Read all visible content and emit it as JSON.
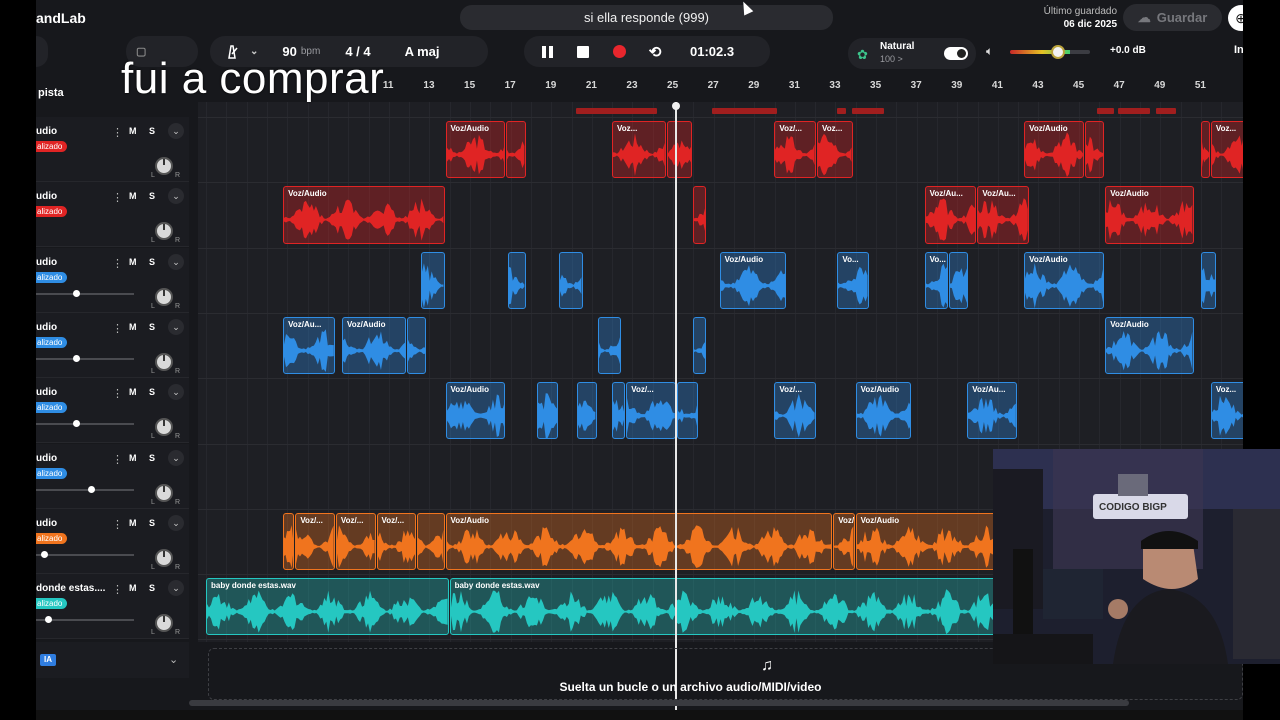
{
  "app": {
    "logo": "andLab",
    "project_title": "si ella responde (999)",
    "last_saved_label": "Último guardado",
    "last_saved_date": "06 dic 2025",
    "save_label": "Guardar"
  },
  "transport": {
    "bpm": "90",
    "bpm_unit": "bpm",
    "time_sig": "4 / 4",
    "key": "A maj",
    "time": "01:02.3",
    "preset_name": "Natural",
    "preset_value": "100 >",
    "master_db": "+0.0 dB",
    "master_volume_fraction": 0.6,
    "right_cut": "In"
  },
  "sidebar": {
    "add_track_label": "pista",
    "tracks": [
      {
        "name": "udio",
        "badge": "alizado",
        "color": "#e02424",
        "has_fader": false
      },
      {
        "name": "udio",
        "badge": "alizado",
        "color": "#e02424",
        "has_fader": false
      },
      {
        "name": "udio",
        "badge": "alizado",
        "color": "#2f8de4",
        "has_fader": true,
        "fader": 0.4
      },
      {
        "name": "udio",
        "badge": "alizado",
        "color": "#2f8de4",
        "has_fader": true,
        "fader": 0.4
      },
      {
        "name": "udio",
        "badge": "alizado",
        "color": "#2f8de4",
        "has_fader": true,
        "fader": 0.4
      },
      {
        "name": "udio",
        "badge": "alizado",
        "color": "#2f8de4",
        "has_fader": true,
        "fader": 0.57
      },
      {
        "name": "udio",
        "badge": "alizado",
        "color": "#f0741e",
        "has_fader": true,
        "fader": 0.05
      },
      {
        "name": "donde estas....",
        "badge": "alizado",
        "color": "#25c7c1",
        "has_fader": true,
        "fader": 0.1
      }
    ],
    "mute_label": "M",
    "solo_label": "S",
    "ia_label": "IA"
  },
  "ruler": {
    "bars": [
      "11",
      "13",
      "15",
      "17",
      "19",
      "21",
      "23",
      "25",
      "27",
      "29",
      "31",
      "33",
      "35",
      "37",
      "39",
      "41",
      "43",
      "45",
      "47",
      "49",
      "51"
    ]
  },
  "clips": [
    {
      "track": 0,
      "start": 11.8,
      "end": 14.8,
      "label": "Voz/Audio"
    },
    {
      "track": 0,
      "start": 14.8,
      "end": 15.8,
      "label": ""
    },
    {
      "track": 0,
      "start": 20.0,
      "end": 22.7,
      "label": "Voz..."
    },
    {
      "track": 0,
      "start": 22.7,
      "end": 24.0,
      "label": ""
    },
    {
      "track": 0,
      "start": 28.0,
      "end": 30.1,
      "label": "Voz/..."
    },
    {
      "track": 0,
      "start": 30.1,
      "end": 31.9,
      "label": "Voz..."
    },
    {
      "track": 0,
      "start": 40.3,
      "end": 43.3,
      "label": "Voz/Audio"
    },
    {
      "track": 0,
      "start": 43.3,
      "end": 44.3,
      "label": ""
    },
    {
      "track": 0,
      "start": 49.0,
      "end": 49.5,
      "label": ""
    },
    {
      "track": 0,
      "start": 49.5,
      "end": 51.5,
      "label": "Voz..."
    },
    {
      "track": 1,
      "start": 3.8,
      "end": 11.8,
      "label": "Voz/Audio"
    },
    {
      "track": 1,
      "start": 24.0,
      "end": 24.7,
      "label": ""
    },
    {
      "track": 1,
      "start": 35.4,
      "end": 38.0,
      "label": "Voz/Au..."
    },
    {
      "track": 1,
      "start": 38.0,
      "end": 40.6,
      "label": "Voz/Au..."
    },
    {
      "track": 1,
      "start": 44.3,
      "end": 48.7,
      "label": "Voz/Audio"
    },
    {
      "track": 2,
      "start": 10.6,
      "end": 11.8,
      "label": ""
    },
    {
      "track": 2,
      "start": 14.9,
      "end": 15.8,
      "label": ""
    },
    {
      "track": 2,
      "start": 17.4,
      "end": 18.6,
      "label": ""
    },
    {
      "track": 2,
      "start": 25.3,
      "end": 28.6,
      "label": "Voz/Audio"
    },
    {
      "track": 2,
      "start": 31.1,
      "end": 32.7,
      "label": "Vo..."
    },
    {
      "track": 2,
      "start": 35.4,
      "end": 36.6,
      "label": "Vo..."
    },
    {
      "track": 2,
      "start": 36.6,
      "end": 37.6,
      "label": ""
    },
    {
      "track": 2,
      "start": 40.3,
      "end": 44.3,
      "label": "Voz/Audio"
    },
    {
      "track": 2,
      "start": 49.0,
      "end": 49.8,
      "label": ""
    },
    {
      "track": 3,
      "start": 3.8,
      "end": 6.4,
      "label": "Voz/Au..."
    },
    {
      "track": 3,
      "start": 6.7,
      "end": 9.9,
      "label": "Voz/Audio"
    },
    {
      "track": 3,
      "start": 9.9,
      "end": 10.9,
      "label": ""
    },
    {
      "track": 3,
      "start": 19.3,
      "end": 20.5,
      "label": ""
    },
    {
      "track": 3,
      "start": 24.0,
      "end": 24.7,
      "label": ""
    },
    {
      "track": 3,
      "start": 44.3,
      "end": 48.7,
      "label": "Voz/Audio"
    },
    {
      "track": 4,
      "start": 11.8,
      "end": 14.8,
      "label": "Voz/Audio"
    },
    {
      "track": 4,
      "start": 16.3,
      "end": 17.4,
      "label": ""
    },
    {
      "track": 4,
      "start": 18.3,
      "end": 19.3,
      "label": ""
    },
    {
      "track": 4,
      "start": 20.0,
      "end": 20.7,
      "label": ""
    },
    {
      "track": 4,
      "start": 20.7,
      "end": 23.2,
      "label": "Voz/..."
    },
    {
      "track": 4,
      "start": 23.2,
      "end": 24.3,
      "label": ""
    },
    {
      "track": 4,
      "start": 28.0,
      "end": 30.1,
      "label": "Voz/..."
    },
    {
      "track": 4,
      "start": 32.0,
      "end": 34.8,
      "label": "Voz/Audio"
    },
    {
      "track": 4,
      "start": 37.5,
      "end": 40.0,
      "label": "Voz/Au..."
    },
    {
      "track": 4,
      "start": 49.5,
      "end": 51.3,
      "label": "Voz..."
    },
    {
      "track": 6,
      "start": 3.8,
      "end": 4.4,
      "label": ""
    },
    {
      "track": 6,
      "start": 4.4,
      "end": 6.4,
      "label": "Voz/..."
    },
    {
      "track": 6,
      "start": 6.4,
      "end": 8.4,
      "label": "Voz/..."
    },
    {
      "track": 6,
      "start": 8.4,
      "end": 10.4,
      "label": "Voz/..."
    },
    {
      "track": 6,
      "start": 10.4,
      "end": 11.8,
      "label": ""
    },
    {
      "track": 6,
      "start": 11.8,
      "end": 30.9,
      "label": "Voz/Audio"
    },
    {
      "track": 6,
      "start": 30.9,
      "end": 32.0,
      "label": "Voz/..."
    },
    {
      "track": 6,
      "start": 32.0,
      "end": 39.0,
      "label": "Voz/Audio"
    },
    {
      "track": 7,
      "start": 0.0,
      "end": 12.0,
      "label": "baby donde estas.wav"
    },
    {
      "track": 7,
      "start": 12.0,
      "end": 39.0,
      "label": "baby donde estas.wav"
    }
  ],
  "markers": [
    {
      "start": 18.6,
      "end": 22.6
    },
    {
      "track": 0,
      "start": 25.3,
      "end": 28.5
    },
    {
      "start": 31.5,
      "end": 31.9
    },
    {
      "start": 32.2,
      "end": 33.8
    },
    {
      "start": 44.3,
      "end": 45.1
    },
    {
      "start": 45.3,
      "end": 46.9
    },
    {
      "start": 47.2,
      "end": 48.2
    }
  ],
  "track_colors": [
    "#e02424",
    "#e02424",
    "#2f8de4",
    "#2f8de4",
    "#2f8de4",
    "#2f8de4",
    "#f0741e",
    "#25c7c1"
  ],
  "dropzone": {
    "text": "Suelta un bucle o un archivo audio/MIDI/video"
  },
  "caption": {
    "text": "fui a comprar"
  },
  "webcam": {
    "sign_text": "CODIGO BIGP"
  }
}
